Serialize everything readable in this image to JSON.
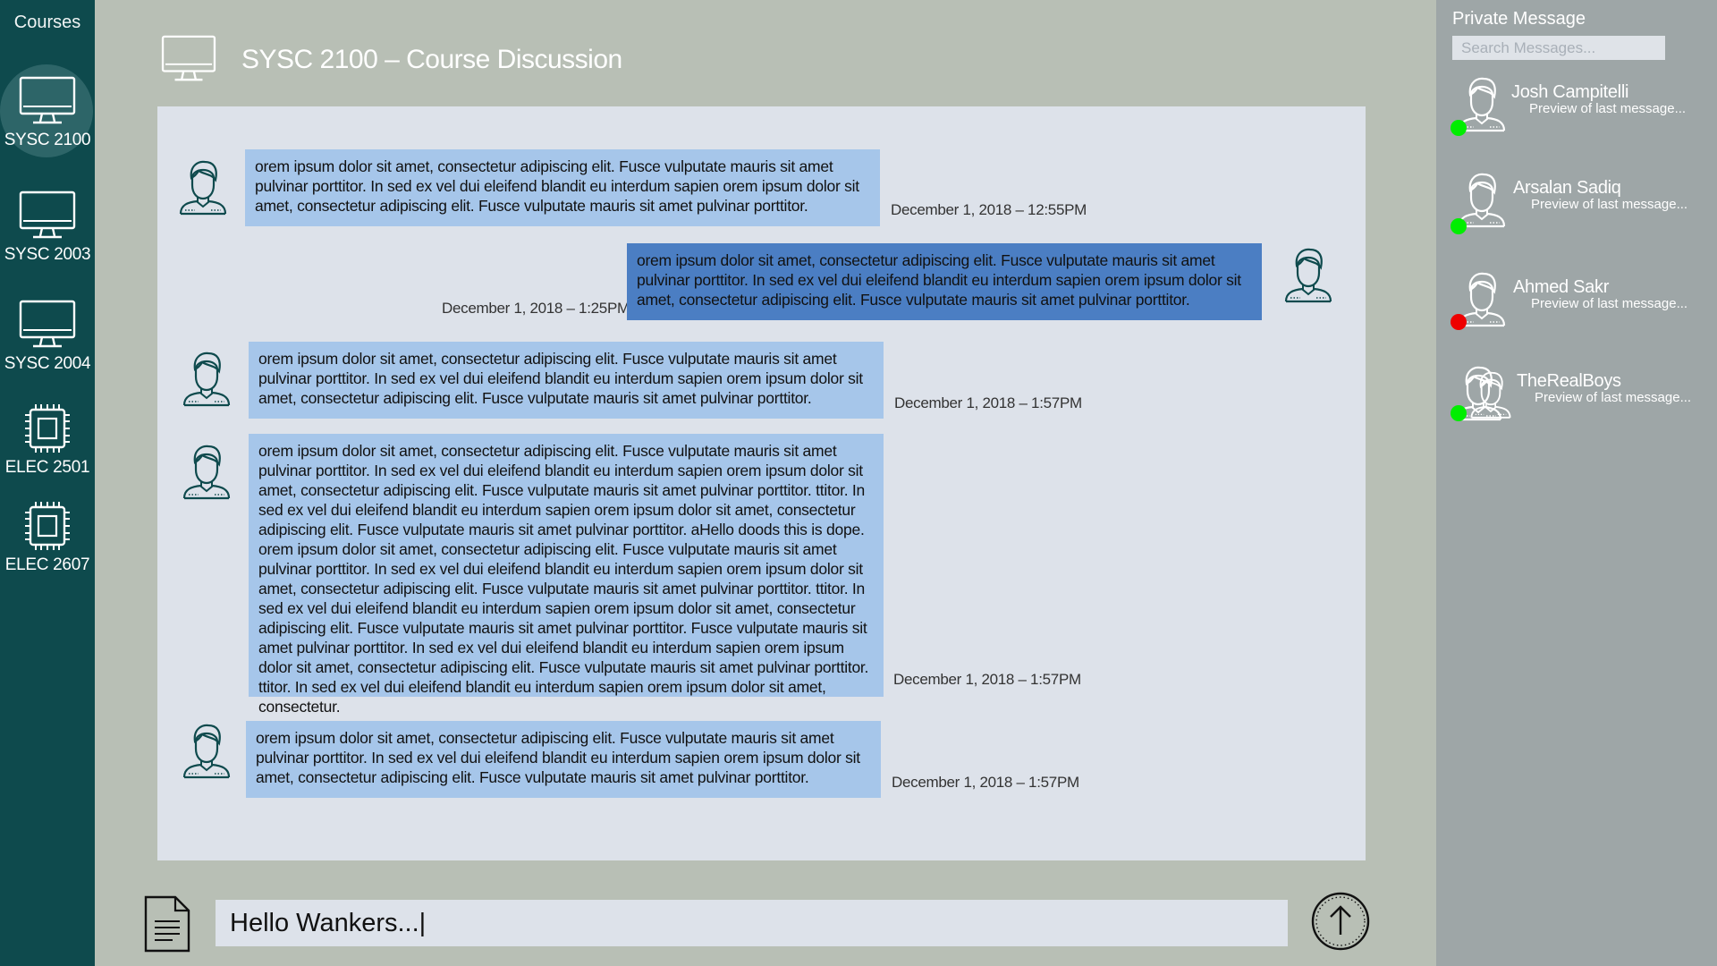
{
  "sidebar": {
    "title": "Courses",
    "courses": [
      {
        "label": "SYSC 2100",
        "icon": "monitor-icon",
        "active": true
      },
      {
        "label": "SYSC 2003",
        "icon": "monitor-icon",
        "active": false
      },
      {
        "label": "SYSC 2004",
        "icon": "monitor-icon",
        "active": false
      },
      {
        "label": "ELEC 2501",
        "icon": "chip-icon",
        "active": false
      },
      {
        "label": "ELEC 2607",
        "icon": "chip-icon",
        "active": false
      }
    ]
  },
  "header": {
    "title": "SYSC 2100 – Course Discussion",
    "icon": "monitor-icon"
  },
  "messages": [
    {
      "sender": "other",
      "text": "orem ipsum dolor sit amet, consectetur adipiscing elit. Fusce vulputate mauris sit amet pulvinar porttitor. In sed ex vel dui eleifend blandit eu interdum sapien orem ipsum dolor sit amet, consectetur adipiscing elit. Fusce vulputate mauris sit amet pulvinar porttitor.",
      "timestamp": "December 1, 2018 – 12:55PM"
    },
    {
      "sender": "self",
      "text": "orem ipsum dolor sit amet, consectetur adipiscing elit. Fusce vulputate mauris sit amet pulvinar porttitor. In sed ex vel dui eleifend blandit eu interdum sapien orem ipsum dolor sit amet, consectetur adipiscing elit. Fusce vulputate mauris sit amet pulvinar porttitor.",
      "timestamp": "December 1, 2018 – 1:25PM"
    },
    {
      "sender": "other",
      "text": "orem ipsum dolor sit amet, consectetur adipiscing elit. Fusce vulputate mauris sit amet pulvinar porttitor. In sed ex vel dui eleifend blandit eu interdum sapien orem ipsum dolor sit amet, consectetur adipiscing elit. Fusce vulputate mauris sit amet pulvinar porttitor.",
      "timestamp": "December 1, 2018 – 1:57PM"
    },
    {
      "sender": "other",
      "text": "orem ipsum dolor sit amet, consectetur adipiscing elit. Fusce vulputate mauris sit amet pulvinar porttitor. In sed ex vel dui eleifend blandit eu interdum sapien orem ipsum dolor sit amet, consectetur adipiscing elit. Fusce vulputate mauris sit amet pulvinar porttitor. ttitor. In sed ex vel dui eleifend blandit eu interdum sapien orem ipsum dolor sit amet, consectetur adipiscing elit. Fusce vulputate mauris sit amet pulvinar porttitor. aHello doods this is dope. orem ipsum dolor sit amet, consectetur adipiscing elit. Fusce vulputate mauris sit amet pulvinar porttitor. In sed ex vel dui eleifend blandit eu interdum sapien orem ipsum dolor sit amet, consectetur adipiscing elit. Fusce vulputate mauris sit amet pulvinar porttitor. ttitor. In sed ex vel dui eleifend blandit eu interdum sapien orem ipsum dolor sit amet, consectetur adipiscing elit. Fusce vulputate mauris sit amet pulvinar porttitor. Fusce vulputate mauris sit  amet pulvinar porttitor. In sed ex vel dui eleifend blandit eu interdum sapien orem ipsum dolor sit  amet, consectetur adipiscing elit. Fusce vulputate mauris sit amet pulvinar porttitor. ttitor. In sed ex vel dui eleifend blandit eu interdum sapien orem ipsum dolor sit amet, consectetur.",
      "timestamp": "December 1, 2018 – 1:57PM"
    },
    {
      "sender": "other",
      "text": "orem ipsum dolor sit amet, consectetur adipiscing elit. Fusce vulputate mauris sit amet pulvinar porttitor. In sed ex vel dui eleifend blandit eu interdum sapien orem ipsum dolor sit amet, consectetur adipiscing elit. Fusce vulputate mauris sit amet pulvinar porttitor.",
      "timestamp": "December 1, 2018 – 1:57PM"
    }
  ],
  "composer": {
    "value": "Hello Wankers...|",
    "attach_icon": "document-icon",
    "send_icon": "arrow-up-circle-icon"
  },
  "private_messages": {
    "title": "Private Message",
    "search_placeholder": "Search Messages...",
    "contacts": [
      {
        "name": "Josh Campitelli",
        "preview": "Preview of last message...",
        "status_color": "#00ee00",
        "avatar": "user-icon"
      },
      {
        "name": "Arsalan Sadiq",
        "preview": "Preview of last message...",
        "status_color": "#00ee00",
        "avatar": "user-icon"
      },
      {
        "name": "Ahmed Sakr",
        "preview": "Preview of last message...",
        "status_color": "#ee0000",
        "avatar": "user-icon"
      },
      {
        "name": "TheRealBoys",
        "preview": "Preview of last message...",
        "status_color": "#00ee00",
        "avatar": "group-icon"
      }
    ]
  },
  "colors": {
    "sidebar": "#0e4a4d",
    "background": "#b8bfb5",
    "chat_panel": "#dde2ea",
    "bubble_other": "#a6c6ea",
    "bubble_self": "#4b7ec3",
    "pm_panel": "#9ea6a7"
  }
}
